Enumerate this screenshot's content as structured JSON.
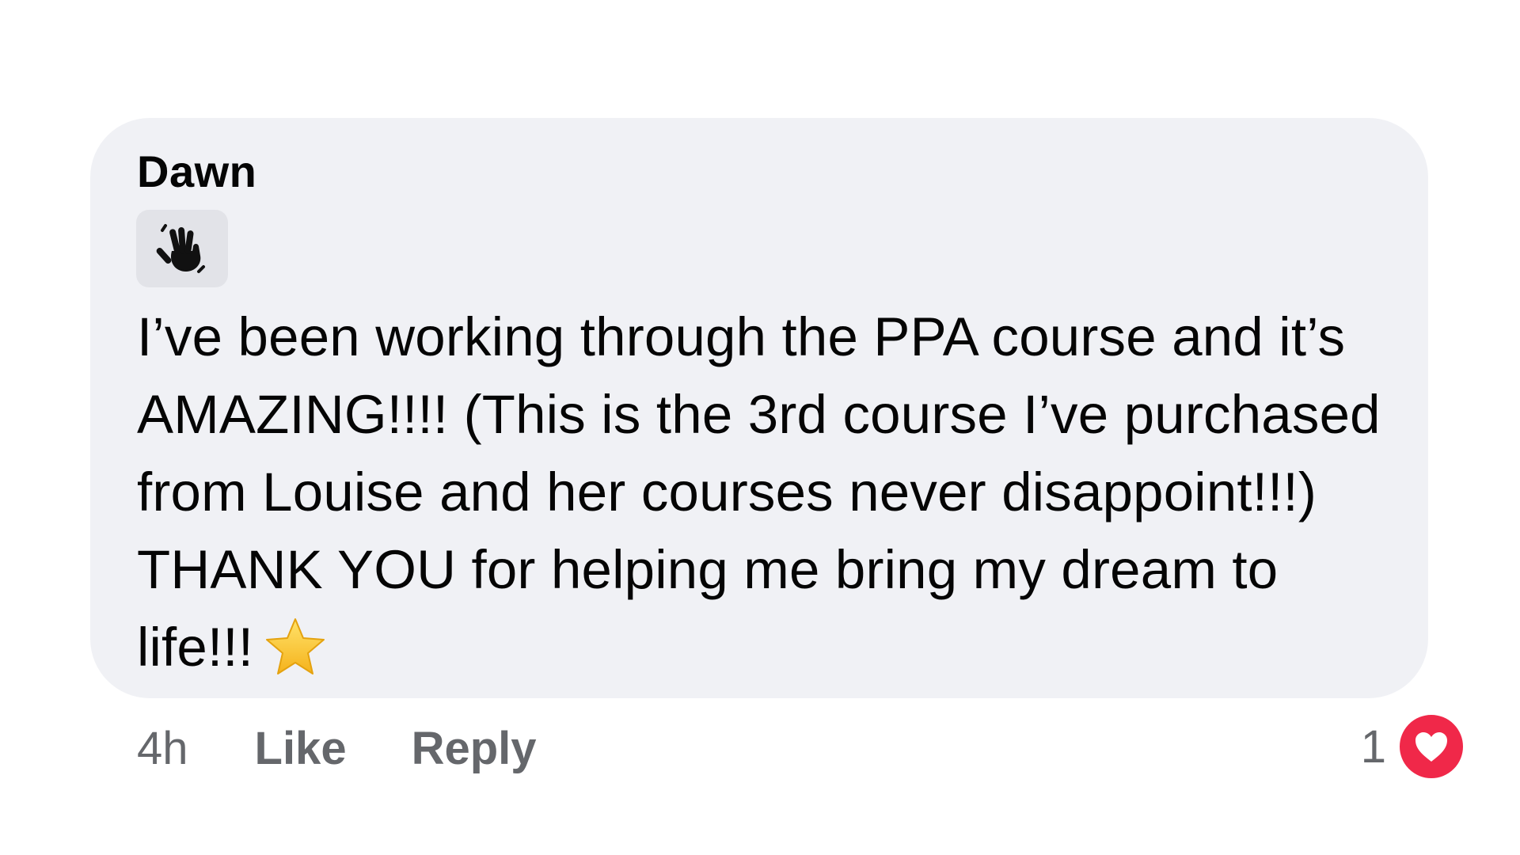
{
  "comment": {
    "author": "Dawn",
    "sticker_icon": "waving-hand-icon",
    "text": "I’ve been working through the PPA course and it’s AMAZING!!!! (This is the 3rd course I’ve purchased from Louise and her courses never disappoint!!!) THANK YOU for helping me bring my dream to life!!!",
    "trailing_emoji_icon": "star-icon"
  },
  "actions": {
    "time": "4h",
    "like_label": "Like",
    "reply_label": "Reply"
  },
  "reactions": {
    "count": "1",
    "icon": "heart-icon",
    "color": "#f02849"
  },
  "colors": {
    "bubble": "#f0f1f5",
    "text": "#050505",
    "secondary_text": "#65676b"
  }
}
